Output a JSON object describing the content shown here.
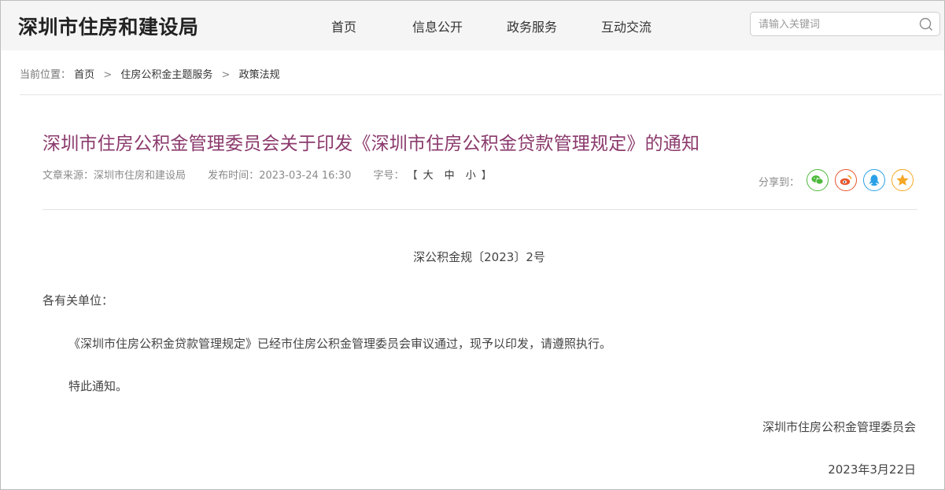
{
  "header": {
    "logo": "深圳市住房和建设局",
    "nav": [
      "首页",
      "信息公开",
      "政务服务",
      "互动交流"
    ],
    "search_placeholder": "请输入关键词",
    "search_icon": "search-icon"
  },
  "breadcrumb": {
    "prefix": "当前位置：",
    "items": [
      "首页",
      "住房公积金主题服务",
      "政策法规"
    ],
    "separator": ">"
  },
  "article": {
    "title": "深圳市住房公积金管理委员会关于印发《深圳市住房公积金贷款管理规定》的通知",
    "source_label": "文章来源：",
    "source": "深圳市住房和建设局",
    "time_label": "发布时间：",
    "time": "2023-03-24 16:30",
    "fontsize_label": "字号：",
    "fontsize_open": "【",
    "fontsize_options": [
      "大",
      "中",
      "小"
    ],
    "fontsize_close": "】",
    "share_label": "分享到：",
    "share_icons": [
      "wechat-icon",
      "weibo-icon",
      "qq-icon",
      "qzone-icon"
    ],
    "doc_number": "深公积金规〔2023〕2号",
    "salutation": "各有关单位：",
    "paragraphs": [
      "《深圳市住房公积金贷款管理规定》已经市住房公积金管理委员会审议通过，现予以印发，请遵照执行。",
      "特此通知。"
    ],
    "signature": "深圳市住房公积金管理委员会",
    "date": "2023年3月22日"
  },
  "colors": {
    "title": "#8b3a6c",
    "wechat": "#4cb93a",
    "weibo": "#e8552d",
    "qq": "#2aa0e6",
    "qzone": "#f5a623",
    "header_bg": "#f5f5f5"
  }
}
